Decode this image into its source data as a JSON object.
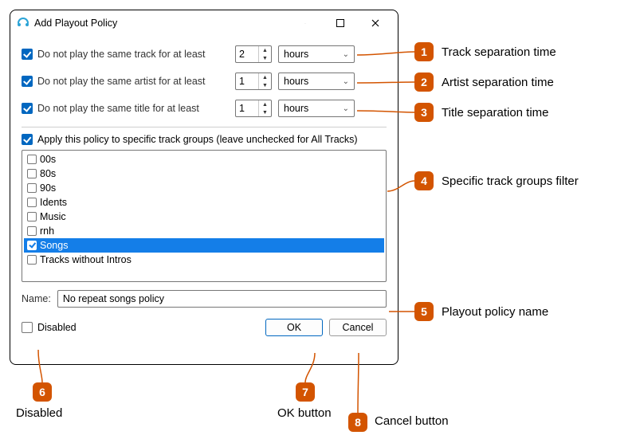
{
  "window": {
    "title": "Add Playout Policy"
  },
  "rules": {
    "track": {
      "label": "Do not play the same track for at least",
      "value": "2",
      "unit": "hours",
      "checked": true
    },
    "artist": {
      "label": "Do not play the same artist for at least",
      "value": "1",
      "unit": "hours",
      "checked": true
    },
    "title": {
      "label": "Do not play the same title for at least",
      "value": "1",
      "unit": "hours",
      "checked": true
    }
  },
  "apply_groups": {
    "label": "Apply this policy to specific track groups (leave unchecked for All Tracks)",
    "checked": true,
    "items": [
      {
        "label": "00s",
        "checked": false,
        "selected": false
      },
      {
        "label": "80s",
        "checked": false,
        "selected": false
      },
      {
        "label": "90s",
        "checked": false,
        "selected": false
      },
      {
        "label": "Idents",
        "checked": false,
        "selected": false
      },
      {
        "label": "Music",
        "checked": false,
        "selected": false
      },
      {
        "label": "rnh",
        "checked": false,
        "selected": false
      },
      {
        "label": "Songs",
        "checked": true,
        "selected": true
      },
      {
        "label": "Tracks without Intros",
        "checked": false,
        "selected": false
      }
    ]
  },
  "name_row": {
    "label": "Name:",
    "value": "No repeat songs policy"
  },
  "disabled": {
    "label": "Disabled",
    "checked": false
  },
  "buttons": {
    "ok": "OK",
    "cancel": "Cancel"
  },
  "callouts": {
    "c1": "Track separation time",
    "c2": "Artist separation time",
    "c3": "Title separation time",
    "c4": "Specific track groups filter",
    "c5": "Playout policy name",
    "c6": "Disabled",
    "c7": "OK button",
    "c8": "Cancel button"
  }
}
